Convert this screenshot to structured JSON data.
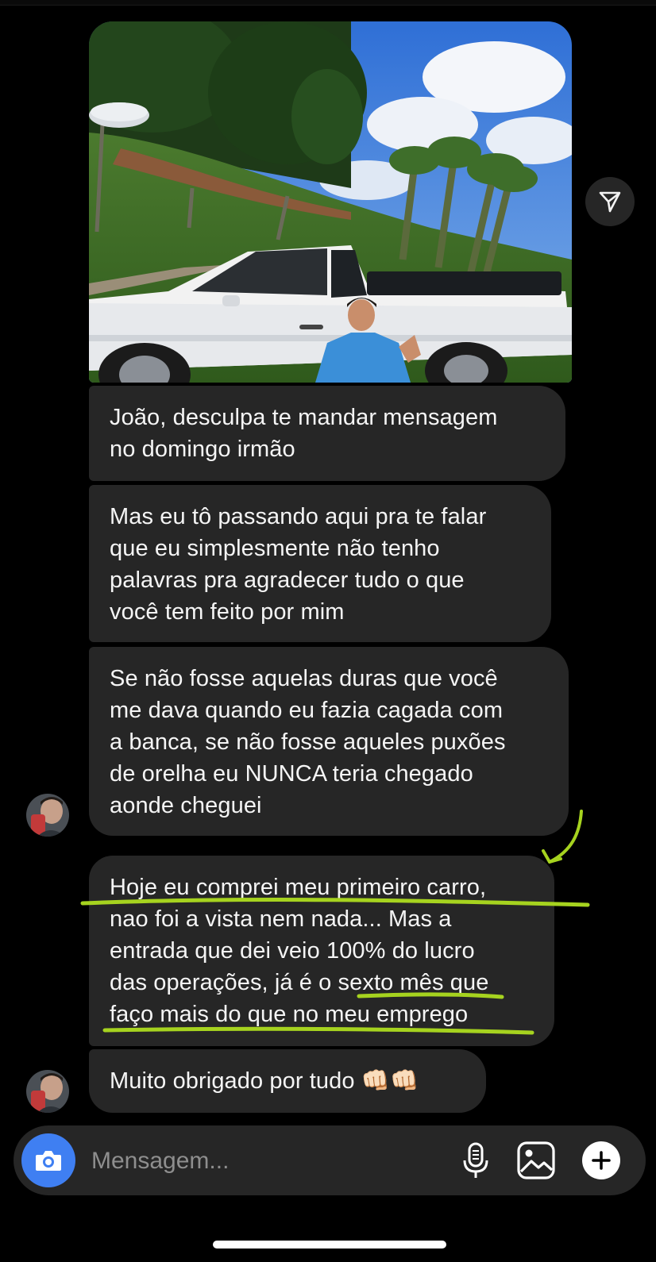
{
  "conversation": {
    "messages": [
      {
        "text": "João, desculpa te mandar mensagem\nno domingo irmão"
      },
      {
        "text": "Mas eu tô passando aqui pra te falar\nque eu simplesmente não tenho\npalavras pra agradecer tudo o que\nvocê tem feito por mim"
      },
      {
        "text": "Se não fosse aquelas duras que você\nme dava quando eu fazia cagada com\na banca, se não fosse aqueles puxões\nde orelha eu NUNCA teria chegado\naonde cheguei"
      },
      {
        "text": "Hoje eu comprei meu primeiro carro,\nnao foi a vista nem nada... Mas a\nentrada que dei veio 100% do lucro\ndas operações, já é o sexto mês que\nfaço mais do que no meu emprego"
      },
      {
        "text": "Muito obrigado por tudo 👊🏻👊🏻"
      }
    ]
  },
  "composer": {
    "placeholder": "Mensagem..."
  },
  "icons": {
    "share": "paper-plane-icon",
    "camera": "camera-icon",
    "mic": "microphone-icon",
    "gallery": "image-gallery-icon",
    "plus": "plus-icon"
  },
  "colors": {
    "background": "#000000",
    "bubble": "#262626",
    "camera_button": "#3f7ff2",
    "highlight": "#a6d31f"
  }
}
